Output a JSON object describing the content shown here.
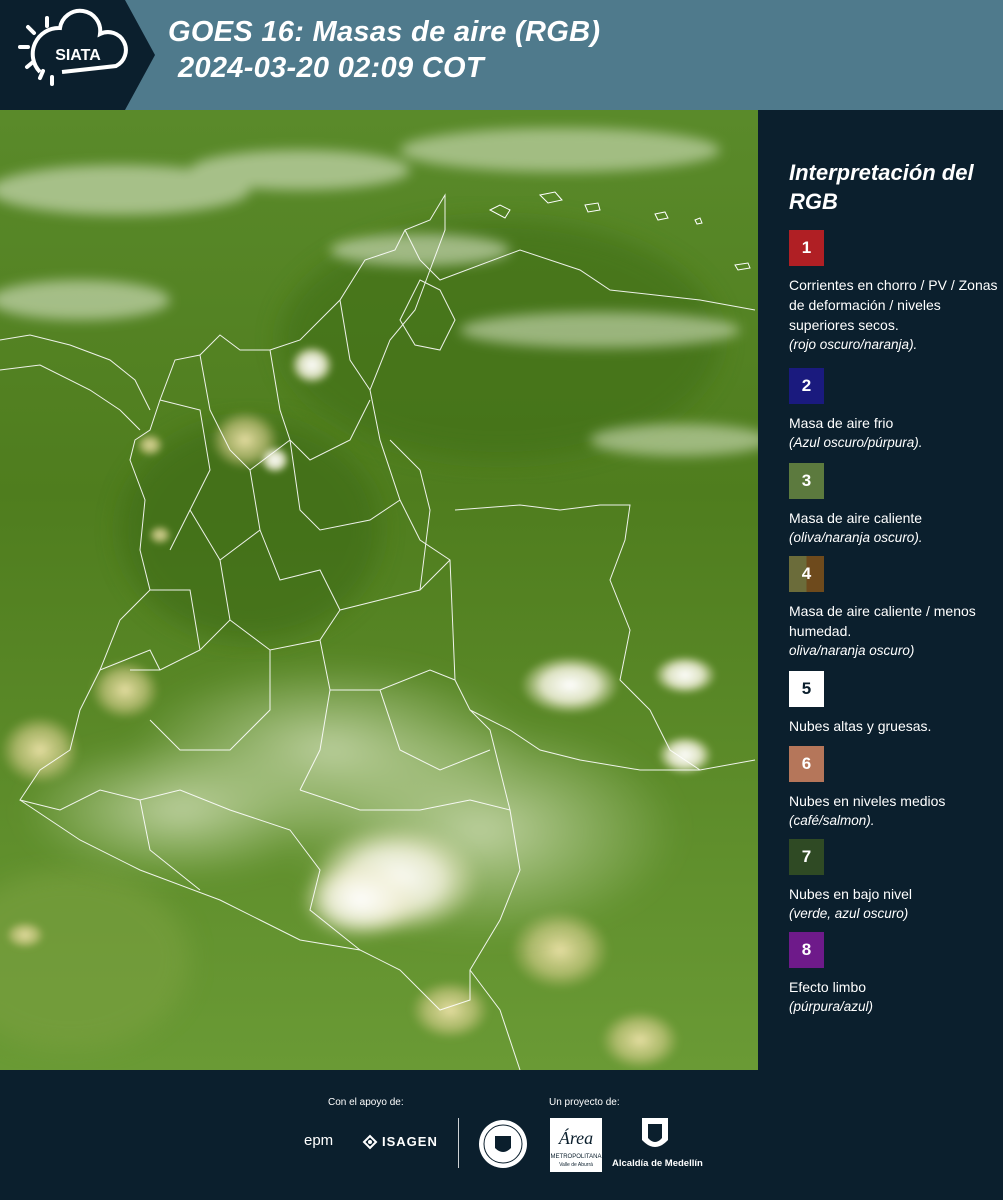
{
  "header": {
    "logo_text": "SIATA",
    "title_line1": "GOES 16: Masas de aire (RGB)",
    "title_line2": "2024-03-20 02:09 COT"
  },
  "legend": {
    "title": "Interpretación del RGB",
    "items": [
      {
        "number": "1",
        "color": "#b01f24",
        "text": "Corrientes en chorro / PV / Zonas de deformación / niveles superiores secos.",
        "note": "(rojo oscuro/naranja)."
      },
      {
        "number": "2",
        "color": "#1a1a7e",
        "text": "Masa de aire frio",
        "note": "(Azul oscuro/púrpura)."
      },
      {
        "number": "3",
        "color": "#5c7a3e",
        "text": "Masa de aire caliente",
        "note": "(oliva/naranja oscuro)."
      },
      {
        "number": "4",
        "color_left": "#6b6c3a",
        "color_right": "#6e4a1c",
        "text": "Masa de aire caliente / menos humedad.",
        "note": "oliva/naranja oscuro)"
      },
      {
        "number": "5",
        "color": "#ffffff",
        "text": "Nubes altas y gruesas.",
        "note": ""
      },
      {
        "number": "6",
        "color": "#b5765a",
        "text": "Nubes en niveles medios",
        "note": "(café/salmon)."
      },
      {
        "number": "7",
        "color": "#2f4a24",
        "text": "Nubes en bajo nivel",
        "note": "(verde, azul oscuro)"
      },
      {
        "number": "8",
        "color": "#6e1a8a",
        "text": "Efecto limbo",
        "note": "(púrpura/azul)"
      }
    ]
  },
  "footer": {
    "support_label": "Con el apoyo de:",
    "project_label": "Un proyecto de:",
    "epm": "epm",
    "isagen": "ISAGEN",
    "amva_name": "Área",
    "amva_sub1": "METROPOLITANA",
    "amva_sub2": "Valle de Aburrá",
    "alcaldia": "Alcaldía de Medellín"
  }
}
